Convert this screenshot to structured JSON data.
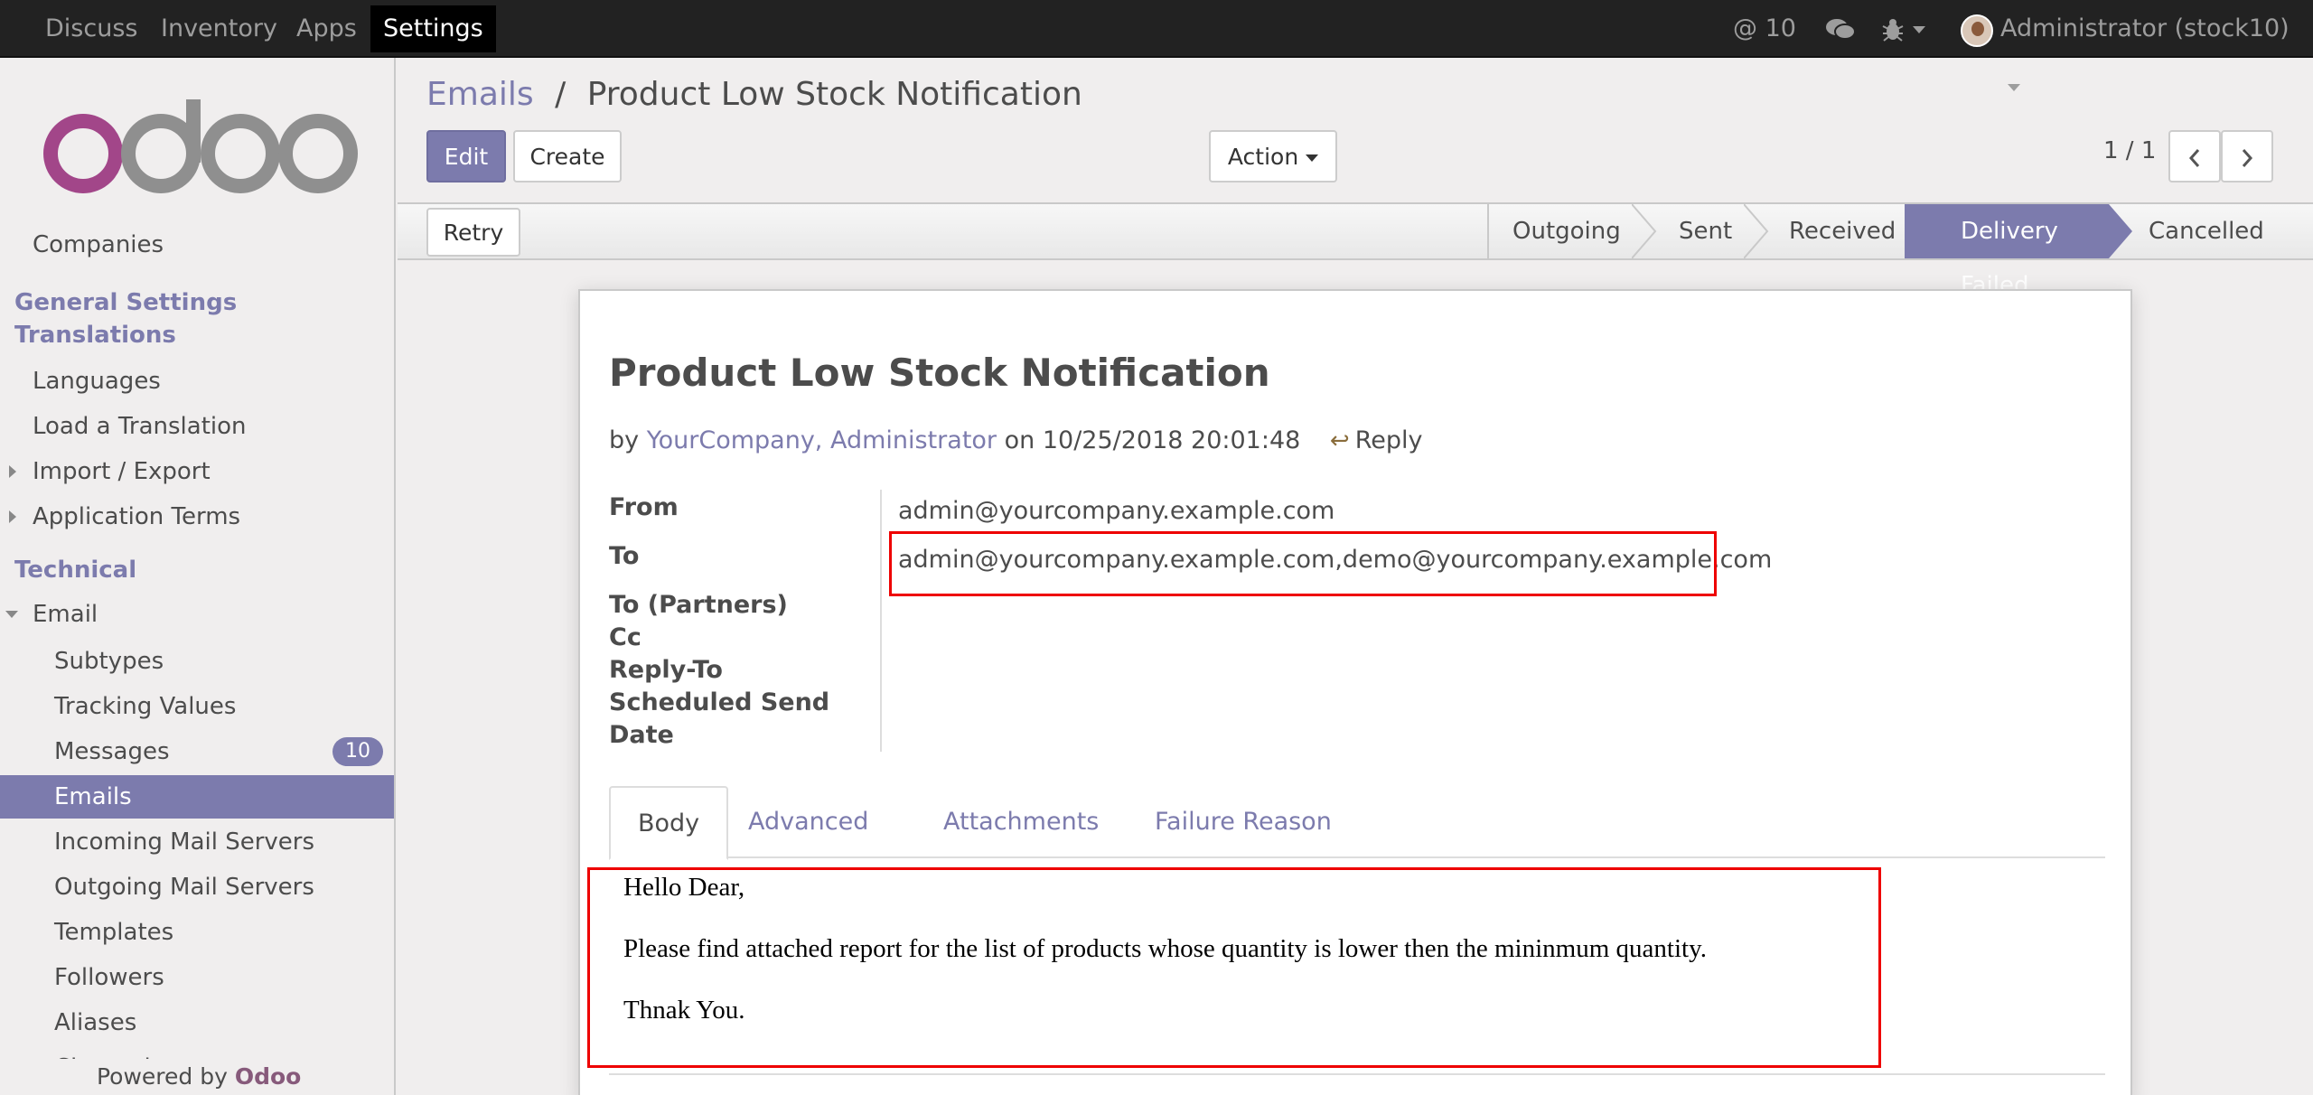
{
  "topbar": {
    "menus": [
      "Discuss",
      "Inventory",
      "Apps",
      "Settings"
    ],
    "mentions": "@ 10",
    "user": "Administrator (stock10)"
  },
  "sidebar": {
    "logo_text": "odoo",
    "cut_top": "Companies",
    "general_settings": "General Settings",
    "translations": "Translations",
    "languages": "Languages",
    "load_translation": "Load a Translation",
    "import_export": "Import / Export",
    "application_terms": "Application Terms",
    "technical": "Technical",
    "email": "Email",
    "subtypes": "Subtypes",
    "tracking_values": "Tracking Values",
    "messages": "Messages",
    "messages_count": "10",
    "emails": "Emails",
    "incoming": "Incoming Mail Servers",
    "outgoing": "Outgoing Mail Servers",
    "templates": "Templates",
    "followers": "Followers",
    "aliases": "Aliases",
    "cut_bottom": "Channels",
    "powered_by": "Powered by",
    "powered_brand": "Odoo"
  },
  "control": {
    "breadcrumb_parent": "Emails",
    "breadcrumb_sep": "/",
    "breadcrumb_current": "Product Low Stock Notification",
    "edit": "Edit",
    "create": "Create",
    "action": "Action",
    "pager": "1 / 1"
  },
  "statusbar": {
    "retry": "Retry",
    "stages": [
      "Outgoing",
      "Sent",
      "Received",
      "Delivery Failed",
      "Cancelled"
    ]
  },
  "mail": {
    "subject": "Product Low Stock Notification",
    "by": "by",
    "author": "YourCompany, Administrator",
    "on": "on 10/25/2018 20:01:48",
    "reply": "Reply",
    "from_label": "From",
    "from_value": "admin@yourcompany.example.com",
    "to_label": "To",
    "to_value": "admin@yourcompany.example.com,demo@yourcompany.example.com",
    "to_partners_label": "To (Partners)",
    "cc_label": "Cc",
    "reply_to_label": "Reply-To",
    "scheduled_label": "Scheduled Send",
    "date_label": "Date",
    "tabs": [
      "Body",
      "Advanced",
      "Attachments",
      "Failure Reason"
    ],
    "body_line1": "Hello Dear,",
    "body_line2": "Please find attached report for the list of products whose quantity is lower then the mininmum quantity.",
    "body_line3": "Thnak You."
  },
  "colors": {
    "accent": "#7c7bad",
    "brand": "#875a7b",
    "highlight": "#e00000"
  }
}
